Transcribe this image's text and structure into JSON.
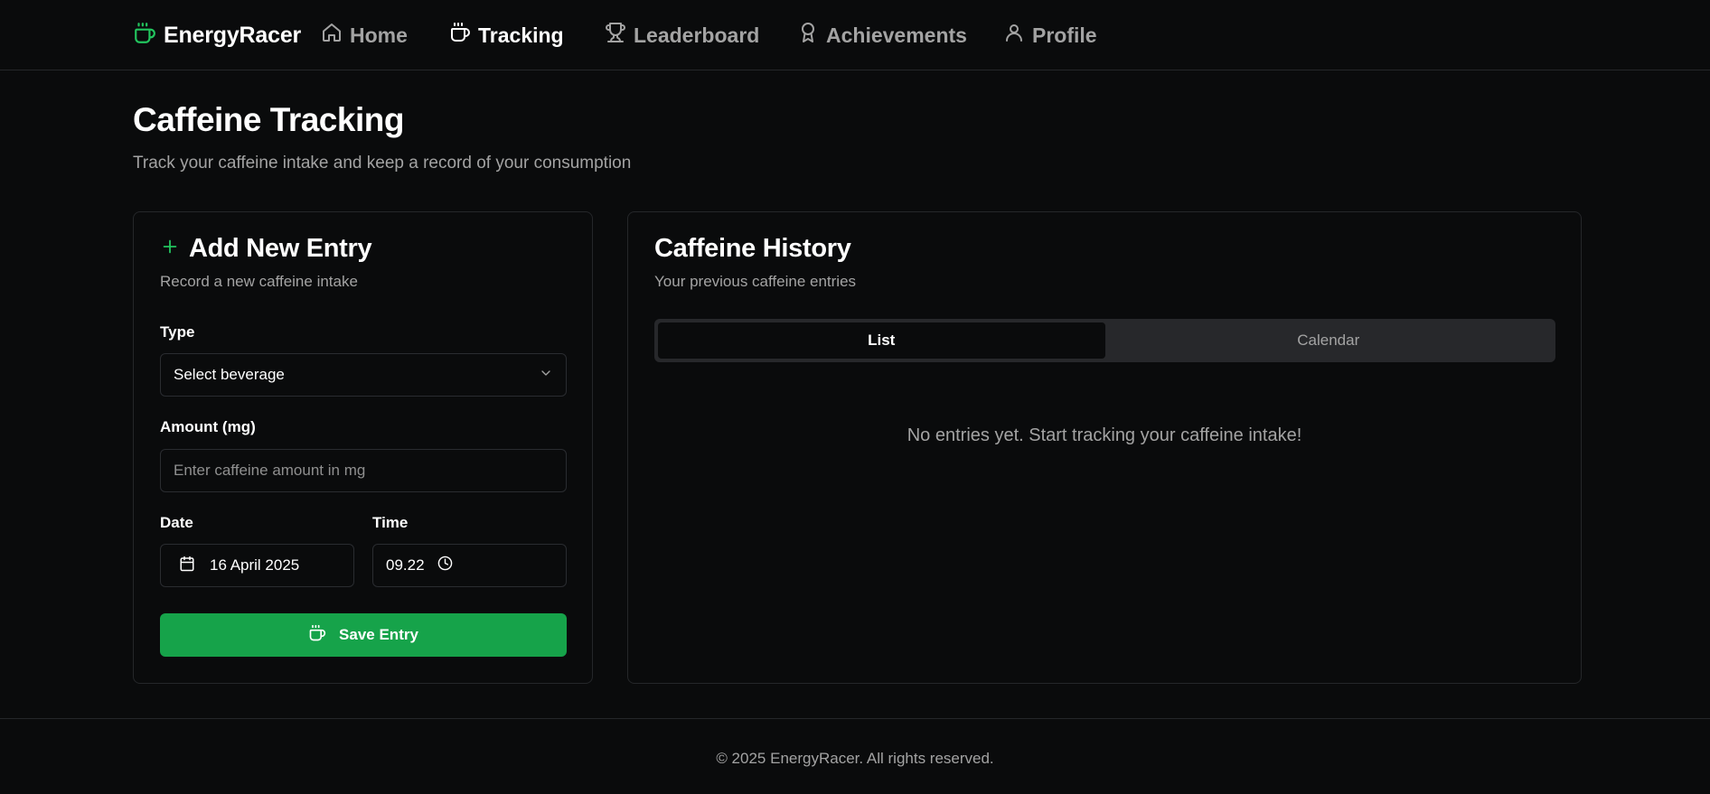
{
  "nav": {
    "brand": "EnergyRacer",
    "items": [
      {
        "label": "Home",
        "icon": "home-icon",
        "active": false
      },
      {
        "label": "Tracking",
        "icon": "coffee-icon",
        "active": true
      },
      {
        "label": "Leaderboard",
        "icon": "trophy-icon",
        "active": false
      },
      {
        "label": "Achievements",
        "icon": "award-icon",
        "active": false
      },
      {
        "label": "Profile",
        "icon": "user-icon",
        "active": false
      }
    ]
  },
  "header": {
    "title": "Caffeine Tracking",
    "subtitle": "Track your caffeine intake and keep a record of your consumption"
  },
  "add_entry": {
    "title": "Add New Entry",
    "description": "Record a new caffeine intake",
    "type_label": "Type",
    "type_value": "Select beverage",
    "amount_label": "Amount (mg)",
    "amount_placeholder": "Enter caffeine amount in mg",
    "date_label": "Date",
    "date_value": "16 April 2025",
    "time_label": "Time",
    "time_value": "09.22",
    "save_label": "Save Entry"
  },
  "history": {
    "title": "Caffeine History",
    "description": "Your previous caffeine entries",
    "tabs": [
      {
        "label": "List",
        "active": true
      },
      {
        "label": "Calendar",
        "active": false
      }
    ],
    "empty_message": "No entries yet. Start tracking your caffeine intake!"
  },
  "footer": {
    "text": "© 2025 EnergyRacer. All rights reserved."
  },
  "colors": {
    "accent": "#16a34a",
    "accent_icon": "#22c55e",
    "background": "#0a0b0c",
    "border": "#25272a",
    "muted_text": "#a3a3a3"
  }
}
